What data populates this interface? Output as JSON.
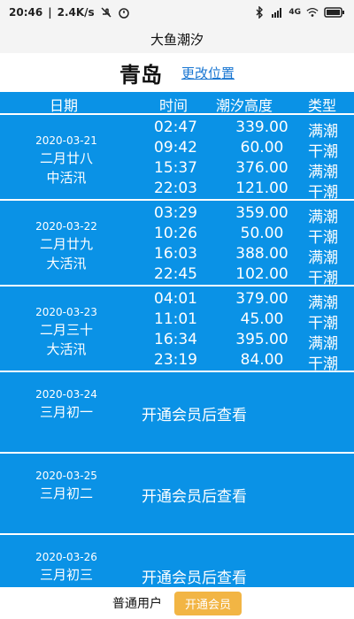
{
  "status": {
    "time": "20:46",
    "speed": "2.4K/s",
    "network": "4G"
  },
  "app": {
    "title": "大鱼潮汐"
  },
  "location": {
    "city": "青岛",
    "change_label": "更改位置"
  },
  "table": {
    "headers": {
      "date": "日期",
      "time": "时间",
      "height": "潮汐高度",
      "type": "类型"
    },
    "days": [
      {
        "date": "2020-03-21",
        "lunar": "二月廿八",
        "tide_type": "中活汛",
        "rows": [
          {
            "time": "02:47",
            "height": "339.00",
            "type": "满潮"
          },
          {
            "time": "09:42",
            "height": "60.00",
            "type": "干潮"
          },
          {
            "time": "15:37",
            "height": "376.00",
            "type": "满潮"
          },
          {
            "time": "22:03",
            "height": "121.00",
            "type": "干潮"
          }
        ]
      },
      {
        "date": "2020-03-22",
        "lunar": "二月廿九",
        "tide_type": "大活汛",
        "rows": [
          {
            "time": "03:29",
            "height": "359.00",
            "type": "满潮"
          },
          {
            "time": "10:26",
            "height": "50.00",
            "type": "干潮"
          },
          {
            "time": "16:03",
            "height": "388.00",
            "type": "满潮"
          },
          {
            "time": "22:45",
            "height": "102.00",
            "type": "干潮"
          }
        ]
      },
      {
        "date": "2020-03-23",
        "lunar": "二月三十",
        "tide_type": "大活汛",
        "rows": [
          {
            "time": "04:01",
            "height": "379.00",
            "type": "满潮"
          },
          {
            "time": "11:01",
            "height": "45.00",
            "type": "干潮"
          },
          {
            "time": "16:34",
            "height": "395.00",
            "type": "满潮"
          },
          {
            "time": "23:19",
            "height": "84.00",
            "type": "干潮"
          }
        ]
      }
    ],
    "locked_days": [
      {
        "date": "2020-03-24",
        "lunar": "三月初一",
        "message": "开通会员后查看"
      },
      {
        "date": "2020-03-25",
        "lunar": "三月初二",
        "message": "开通会员后查看"
      },
      {
        "date": "2020-03-26",
        "lunar": "三月初三",
        "message": "开通会员后查看"
      }
    ]
  },
  "bottom": {
    "user_type": "普通用户",
    "vip_button": "开通会员"
  }
}
